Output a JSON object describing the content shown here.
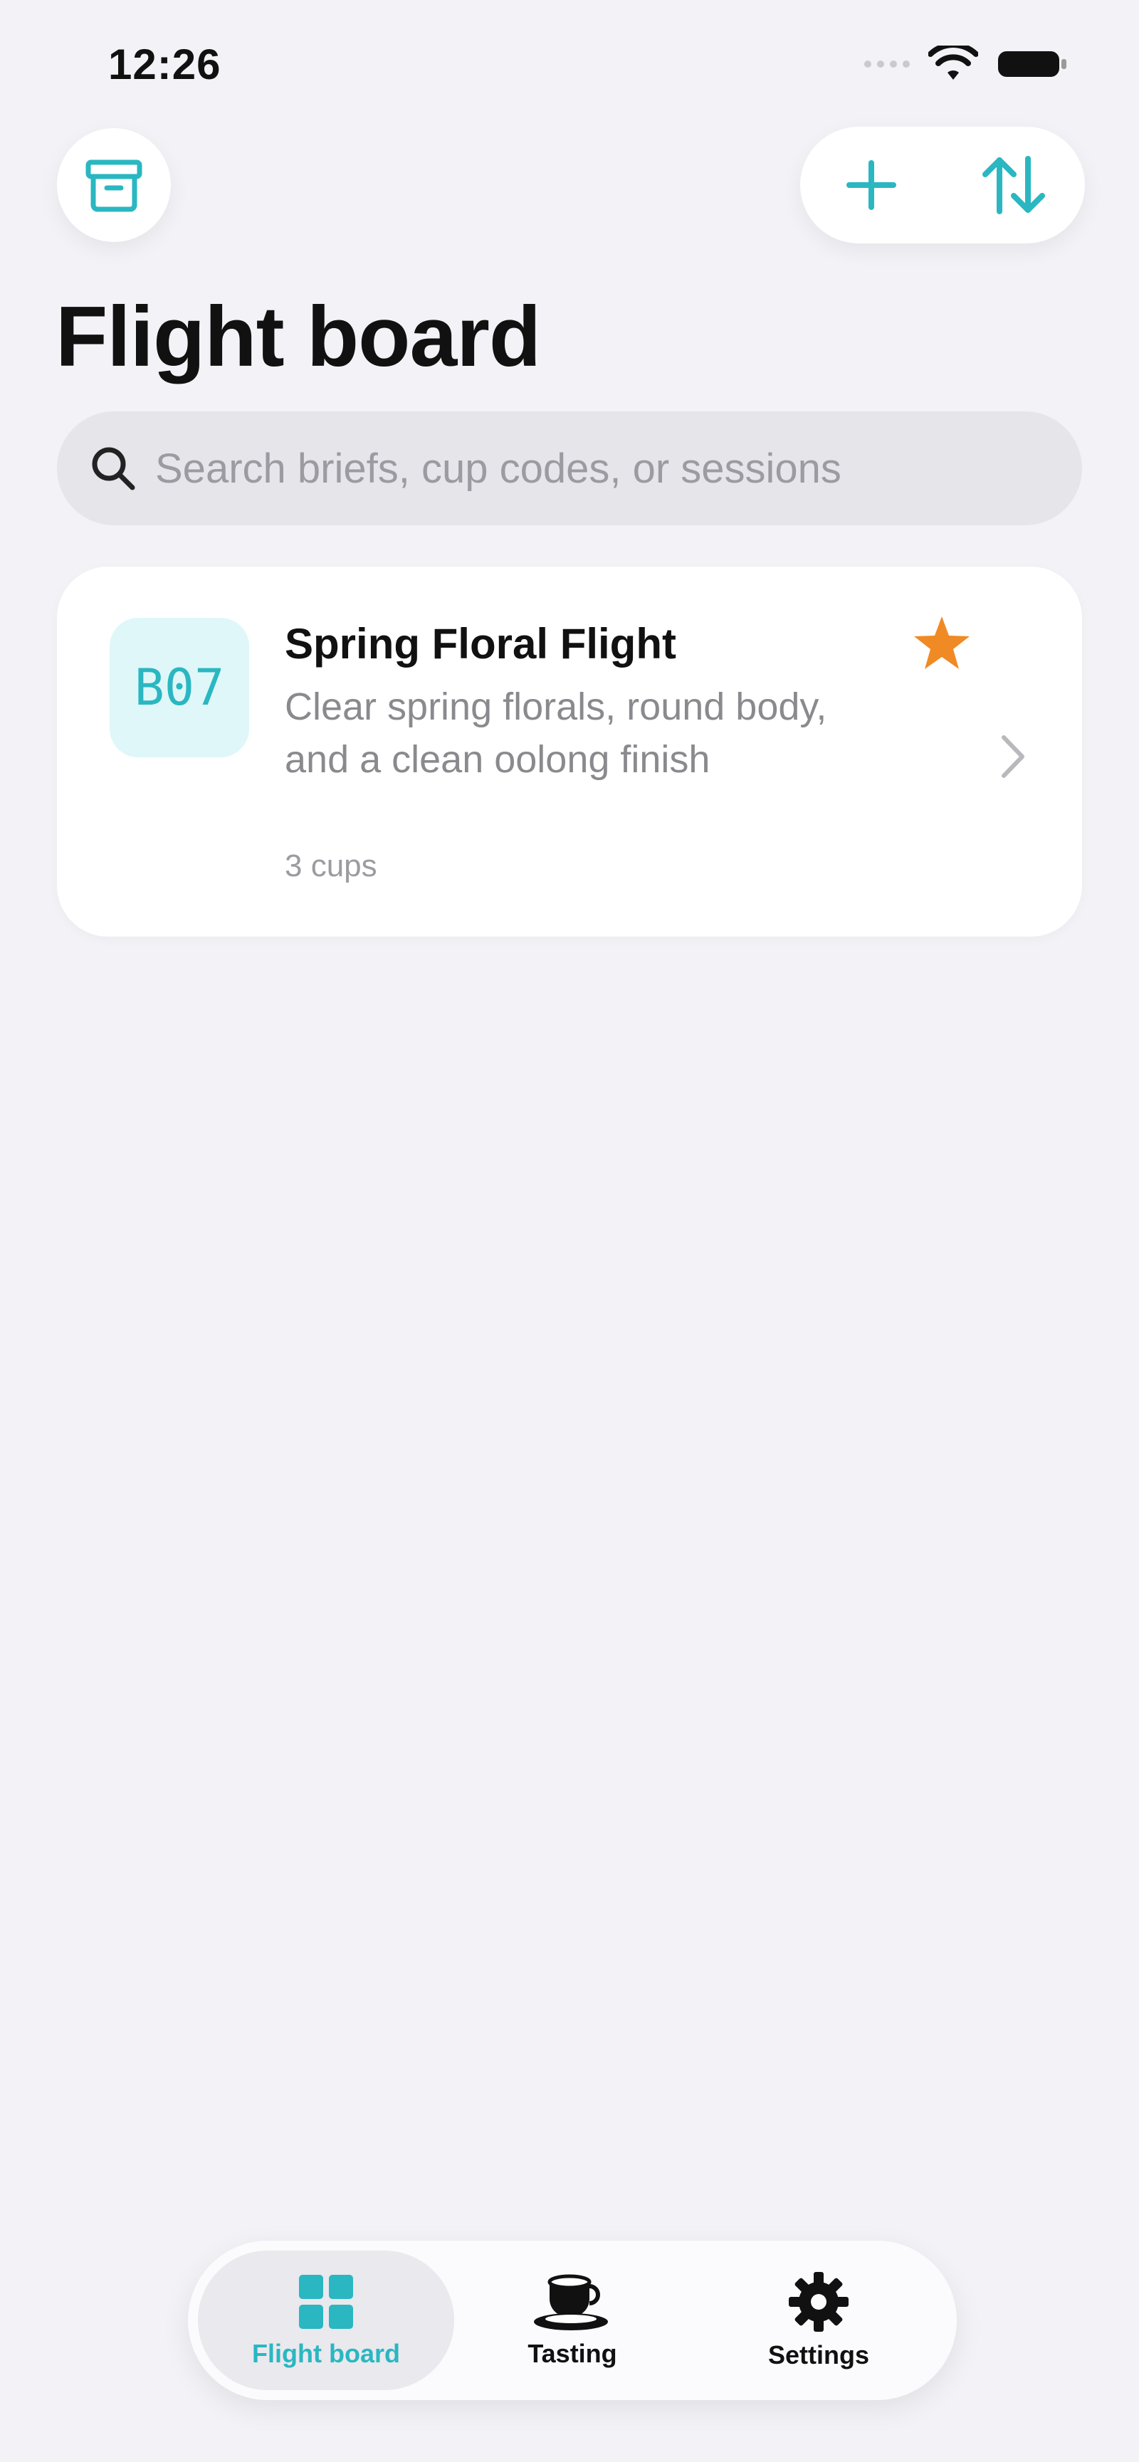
{
  "status_bar": {
    "time": "12:26"
  },
  "header": {
    "title": "Flight board",
    "archive_icon": "archive-box-icon",
    "add_icon": "plus-icon",
    "sort_icon": "sort-arrows-icon"
  },
  "search": {
    "placeholder": "Search briefs, cup codes, or sessions",
    "value": ""
  },
  "flights": [
    {
      "code": "B07",
      "title": "Spring Floral Flight",
      "description": "Clear spring florals, round body, and a clean oolong finish",
      "cups": "3 cups",
      "starred": true
    }
  ],
  "tabbar": {
    "items": [
      {
        "label": "Flight board",
        "icon": "grid-icon",
        "active": true
      },
      {
        "label": "Tasting",
        "icon": "teacup-icon",
        "active": false
      },
      {
        "label": "Settings",
        "icon": "gear-icon",
        "active": false
      }
    ]
  },
  "colors": {
    "accent": "#2ab7c1",
    "star": "#f08a24",
    "background": "#f2f2f7"
  }
}
